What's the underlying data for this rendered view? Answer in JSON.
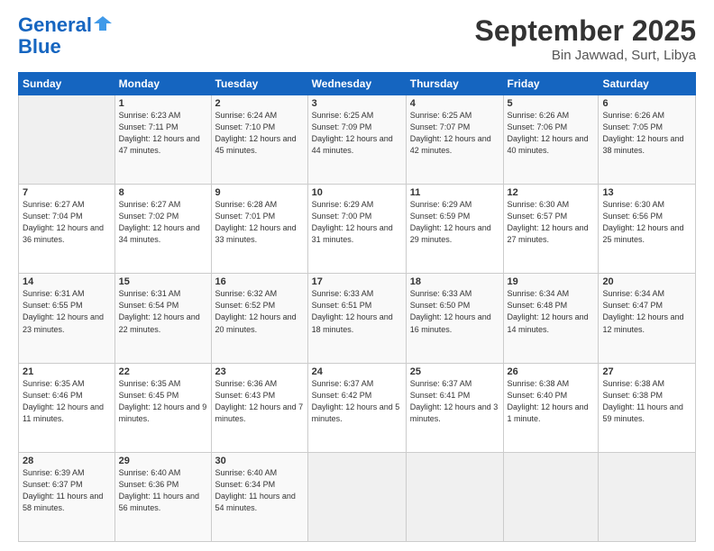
{
  "header": {
    "logo_line1": "General",
    "logo_line2": "Blue",
    "month": "September 2025",
    "location": "Bin Jawwad, Surt, Libya"
  },
  "days_of_week": [
    "Sunday",
    "Monday",
    "Tuesday",
    "Wednesday",
    "Thursday",
    "Friday",
    "Saturday"
  ],
  "weeks": [
    [
      {
        "day": "",
        "sunrise": "",
        "sunset": "",
        "daylight": ""
      },
      {
        "day": "1",
        "sunrise": "Sunrise: 6:23 AM",
        "sunset": "Sunset: 7:11 PM",
        "daylight": "Daylight: 12 hours and 47 minutes."
      },
      {
        "day": "2",
        "sunrise": "Sunrise: 6:24 AM",
        "sunset": "Sunset: 7:10 PM",
        "daylight": "Daylight: 12 hours and 45 minutes."
      },
      {
        "day": "3",
        "sunrise": "Sunrise: 6:25 AM",
        "sunset": "Sunset: 7:09 PM",
        "daylight": "Daylight: 12 hours and 44 minutes."
      },
      {
        "day": "4",
        "sunrise": "Sunrise: 6:25 AM",
        "sunset": "Sunset: 7:07 PM",
        "daylight": "Daylight: 12 hours and 42 minutes."
      },
      {
        "day": "5",
        "sunrise": "Sunrise: 6:26 AM",
        "sunset": "Sunset: 7:06 PM",
        "daylight": "Daylight: 12 hours and 40 minutes."
      },
      {
        "day": "6",
        "sunrise": "Sunrise: 6:26 AM",
        "sunset": "Sunset: 7:05 PM",
        "daylight": "Daylight: 12 hours and 38 minutes."
      }
    ],
    [
      {
        "day": "7",
        "sunrise": "Sunrise: 6:27 AM",
        "sunset": "Sunset: 7:04 PM",
        "daylight": "Daylight: 12 hours and 36 minutes."
      },
      {
        "day": "8",
        "sunrise": "Sunrise: 6:27 AM",
        "sunset": "Sunset: 7:02 PM",
        "daylight": "Daylight: 12 hours and 34 minutes."
      },
      {
        "day": "9",
        "sunrise": "Sunrise: 6:28 AM",
        "sunset": "Sunset: 7:01 PM",
        "daylight": "Daylight: 12 hours and 33 minutes."
      },
      {
        "day": "10",
        "sunrise": "Sunrise: 6:29 AM",
        "sunset": "Sunset: 7:00 PM",
        "daylight": "Daylight: 12 hours and 31 minutes."
      },
      {
        "day": "11",
        "sunrise": "Sunrise: 6:29 AM",
        "sunset": "Sunset: 6:59 PM",
        "daylight": "Daylight: 12 hours and 29 minutes."
      },
      {
        "day": "12",
        "sunrise": "Sunrise: 6:30 AM",
        "sunset": "Sunset: 6:57 PM",
        "daylight": "Daylight: 12 hours and 27 minutes."
      },
      {
        "day": "13",
        "sunrise": "Sunrise: 6:30 AM",
        "sunset": "Sunset: 6:56 PM",
        "daylight": "Daylight: 12 hours and 25 minutes."
      }
    ],
    [
      {
        "day": "14",
        "sunrise": "Sunrise: 6:31 AM",
        "sunset": "Sunset: 6:55 PM",
        "daylight": "Daylight: 12 hours and 23 minutes."
      },
      {
        "day": "15",
        "sunrise": "Sunrise: 6:31 AM",
        "sunset": "Sunset: 6:54 PM",
        "daylight": "Daylight: 12 hours and 22 minutes."
      },
      {
        "day": "16",
        "sunrise": "Sunrise: 6:32 AM",
        "sunset": "Sunset: 6:52 PM",
        "daylight": "Daylight: 12 hours and 20 minutes."
      },
      {
        "day": "17",
        "sunrise": "Sunrise: 6:33 AM",
        "sunset": "Sunset: 6:51 PM",
        "daylight": "Daylight: 12 hours and 18 minutes."
      },
      {
        "day": "18",
        "sunrise": "Sunrise: 6:33 AM",
        "sunset": "Sunset: 6:50 PM",
        "daylight": "Daylight: 12 hours and 16 minutes."
      },
      {
        "day": "19",
        "sunrise": "Sunrise: 6:34 AM",
        "sunset": "Sunset: 6:48 PM",
        "daylight": "Daylight: 12 hours and 14 minutes."
      },
      {
        "day": "20",
        "sunrise": "Sunrise: 6:34 AM",
        "sunset": "Sunset: 6:47 PM",
        "daylight": "Daylight: 12 hours and 12 minutes."
      }
    ],
    [
      {
        "day": "21",
        "sunrise": "Sunrise: 6:35 AM",
        "sunset": "Sunset: 6:46 PM",
        "daylight": "Daylight: 12 hours and 11 minutes."
      },
      {
        "day": "22",
        "sunrise": "Sunrise: 6:35 AM",
        "sunset": "Sunset: 6:45 PM",
        "daylight": "Daylight: 12 hours and 9 minutes."
      },
      {
        "day": "23",
        "sunrise": "Sunrise: 6:36 AM",
        "sunset": "Sunset: 6:43 PM",
        "daylight": "Daylight: 12 hours and 7 minutes."
      },
      {
        "day": "24",
        "sunrise": "Sunrise: 6:37 AM",
        "sunset": "Sunset: 6:42 PM",
        "daylight": "Daylight: 12 hours and 5 minutes."
      },
      {
        "day": "25",
        "sunrise": "Sunrise: 6:37 AM",
        "sunset": "Sunset: 6:41 PM",
        "daylight": "Daylight: 12 hours and 3 minutes."
      },
      {
        "day": "26",
        "sunrise": "Sunrise: 6:38 AM",
        "sunset": "Sunset: 6:40 PM",
        "daylight": "Daylight: 12 hours and 1 minute."
      },
      {
        "day": "27",
        "sunrise": "Sunrise: 6:38 AM",
        "sunset": "Sunset: 6:38 PM",
        "daylight": "Daylight: 11 hours and 59 minutes."
      }
    ],
    [
      {
        "day": "28",
        "sunrise": "Sunrise: 6:39 AM",
        "sunset": "Sunset: 6:37 PM",
        "daylight": "Daylight: 11 hours and 58 minutes."
      },
      {
        "day": "29",
        "sunrise": "Sunrise: 6:40 AM",
        "sunset": "Sunset: 6:36 PM",
        "daylight": "Daylight: 11 hours and 56 minutes."
      },
      {
        "day": "30",
        "sunrise": "Sunrise: 6:40 AM",
        "sunset": "Sunset: 6:34 PM",
        "daylight": "Daylight: 11 hours and 54 minutes."
      },
      {
        "day": "",
        "sunrise": "",
        "sunset": "",
        "daylight": ""
      },
      {
        "day": "",
        "sunrise": "",
        "sunset": "",
        "daylight": ""
      },
      {
        "day": "",
        "sunrise": "",
        "sunset": "",
        "daylight": ""
      },
      {
        "day": "",
        "sunrise": "",
        "sunset": "",
        "daylight": ""
      }
    ]
  ]
}
